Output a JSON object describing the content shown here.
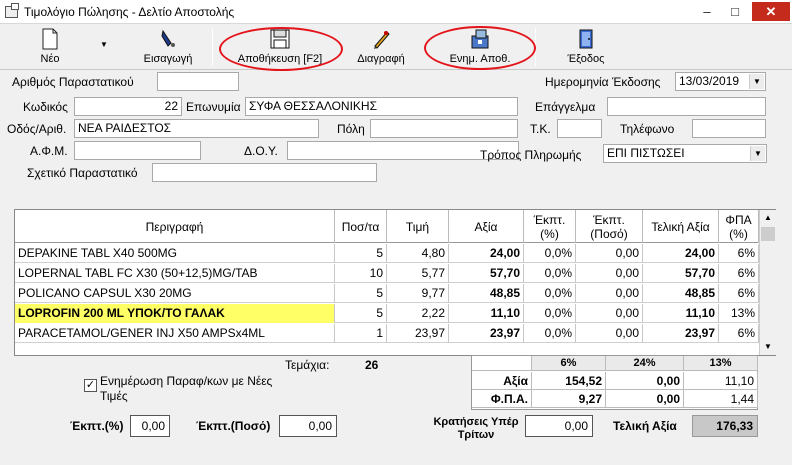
{
  "window": {
    "title": "Τιμολόγιο Πώλησης - Δελτίο Αποστολής",
    "minimize": "–",
    "maximize": "□",
    "close": "✕"
  },
  "toolbar": {
    "new": "Νέο",
    "import": "Εισαγωγή",
    "save": "Αποθήκευση [F2]",
    "delete": "Διαγραφή",
    "update_stock": "Ενημ. Αποθ.",
    "exit": "Έξοδος",
    "dropdown": "▼"
  },
  "form": {
    "doc_number_label": "Αριθμός Παραστατικού",
    "doc_number": "",
    "issue_date_label": "Ημερομηνία Έκδοσης",
    "issue_date": "13/03/2019",
    "code_label": "Κωδικός",
    "code": "22",
    "name_label": "Επωνυμία",
    "name": "ΣΥΦΑ ΘΕΣΣΑΛΟΝΙΚΗΣ",
    "profession_label": "Επάγγελμα",
    "profession": "",
    "address_label": "Οδός/Αριθ.",
    "address": "ΝΕΑ ΡΑΙΔΕΣΤΟΣ",
    "city_label": "Πόλη",
    "city": "",
    "zip_label": "Τ.Κ.",
    "zip": "",
    "phone_label": "Τηλέφωνο",
    "phone": "",
    "afm_label": "Α.Φ.Μ.",
    "afm": "",
    "doy_label": "Δ.Ο.Υ.",
    "doy": "",
    "payment_label": "Τρόπος Πληρωμής",
    "payment": "ΕΠΙ ΠΙΣΤΩΣΕΙ",
    "related_label": "Σχετικό Παραστατικό",
    "related": ""
  },
  "grid": {
    "headers": [
      "Περιγραφή",
      "Ποσ/τα",
      "Τιμή",
      "Αξία",
      "Έκπτ. (%)",
      "Έκπτ. (Ποσό)",
      "Τελική Αξία",
      "ΦΠΑ (%)"
    ],
    "rows": [
      {
        "desc": "DEPAKINE TABL X40 500MG",
        "qty": "5",
        "price": "4,80",
        "value": "24,00",
        "disc_pct": "0,0%",
        "disc_amt": "0,00",
        "final": "24,00",
        "vat": "6%"
      },
      {
        "desc": "LOPERNAL TABL FC X30 (50+12,5)MG/TAB",
        "qty": "10",
        "price": "5,77",
        "value": "57,70",
        "disc_pct": "0,0%",
        "disc_amt": "0,00",
        "final": "57,70",
        "vat": "6%"
      },
      {
        "desc": "POLICANO CAPSUL X30 20MG",
        "qty": "5",
        "price": "9,77",
        "value": "48,85",
        "disc_pct": "0,0%",
        "disc_amt": "0,00",
        "final": "48,85",
        "vat": "6%"
      },
      {
        "desc": "LOPROFIN  200 ML ΥΠΟΚ/ΤΟ ΓΑΛΑΚ",
        "qty": "5",
        "price": "2,22",
        "value": "11,10",
        "disc_pct": "0,0%",
        "disc_amt": "0,00",
        "final": "11,10",
        "vat": "13%"
      },
      {
        "desc": "PARACETAMOL/GENER INJ X50 AMPSx4ML",
        "qty": "1",
        "price": "23,97",
        "value": "23,97",
        "disc_pct": "0,0%",
        "disc_amt": "0,00",
        "final": "23,97",
        "vat": "6%"
      }
    ]
  },
  "summary": {
    "pieces_label": "Τεμάχια:",
    "pieces": "26",
    "update_prices_label": "Ενημέρωση Παραφ/κων με Νέες Τιμές",
    "update_prices_checked": "✓",
    "vat_headers": [
      "6%",
      "24%",
      "13%"
    ],
    "value_label": "Αξία",
    "value_row": [
      "154,52",
      "0,00",
      "11,10"
    ],
    "fpa_label": "Φ.Π.Α.",
    "fpa_row": [
      "9,27",
      "0,00",
      "1,44"
    ],
    "disc_pct_label": "Έκπτ.(%)",
    "disc_pct": "0,00",
    "disc_amt_label": "Έκπτ.(Ποσό)",
    "disc_amt": "0,00",
    "withholding_label": "Κρατήσεις Υπέρ Τρίτων",
    "withholding": "0,00",
    "total_label": "Τελική Αξία",
    "total": "176,33"
  },
  "colors": {
    "highlight_row": "#ffff66",
    "annotation_ring": "#e4141b",
    "close_button": "#c42b1c"
  }
}
